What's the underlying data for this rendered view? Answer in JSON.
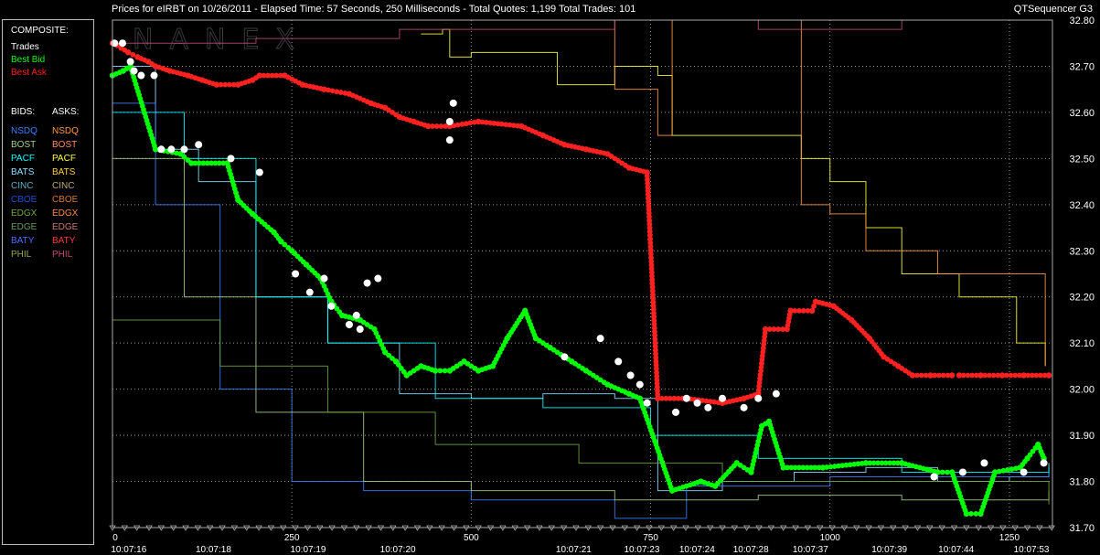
{
  "window": {
    "title": "Prices for  eIRBT  on  10/26/2011  -  Elapsed Time: 57 Seconds, 250 Milliseconds  -  Total Quotes: 1,199  Total Trades: 101",
    "app_name": "QTSequencer G3"
  },
  "watermark": "NANEX",
  "legend": {
    "composite_header": "COMPOSITE:",
    "composite": [
      {
        "label": "Trades",
        "color": "#ffffff"
      },
      {
        "label": "Best Bid",
        "color": "#00ff00"
      },
      {
        "label": "Best Ask",
        "color": "#ff2020"
      }
    ],
    "bids_header": "BIDS:",
    "asks_header": "ASKS:",
    "bids": [
      {
        "label": "NSDQ",
        "color": "#3f7fff"
      },
      {
        "label": "BOST",
        "color": "#a8d08a"
      },
      {
        "label": "PACF",
        "color": "#00ffff"
      },
      {
        "label": "BATS",
        "color": "#8fe0ff"
      },
      {
        "label": "CINC",
        "color": "#5fb0c0"
      },
      {
        "label": "CBOE",
        "color": "#1f4fd0"
      },
      {
        "label": "EDGX",
        "color": "#6fa83f"
      },
      {
        "label": "EDGE",
        "color": "#5f9f5f"
      },
      {
        "label": "BATY",
        "color": "#4f6fff"
      },
      {
        "label": "PHIL",
        "color": "#8faf40"
      }
    ],
    "asks": [
      {
        "label": "NSDQ",
        "color": "#ff9a3f"
      },
      {
        "label": "BOST",
        "color": "#ff8c60"
      },
      {
        "label": "PACF",
        "color": "#ffff40"
      },
      {
        "label": "BATS",
        "color": "#ffd040"
      },
      {
        "label": "CINC",
        "color": "#c0a878"
      },
      {
        "label": "CBOE",
        "color": "#d87a2a"
      },
      {
        "label": "EDGX",
        "color": "#ff8a50"
      },
      {
        "label": "EDGE",
        "color": "#d07a70"
      },
      {
        "label": "BATY",
        "color": "#ff3a3a"
      },
      {
        "label": "PHIL",
        "color": "#c04a78"
      }
    ]
  },
  "chart_data": {
    "type": "scatter",
    "y_axis": {
      "range": [
        31.7,
        32.8
      ],
      "ticks": [
        "32.80",
        "32.70",
        "32.60",
        "32.50",
        "32.40",
        "32.30",
        "32.20",
        "32.10",
        "32.00",
        "31.90",
        "31.80",
        "31.70"
      ],
      "side": "right"
    },
    "x_axis": {
      "range": [
        0,
        1310
      ],
      "count_ticks": [
        {
          "value": 0,
          "label": "0"
        },
        {
          "value": 250,
          "label": "250"
        },
        {
          "value": 500,
          "label": "500"
        },
        {
          "value": 750,
          "label": "750"
        },
        {
          "value": 1000,
          "label": "1000"
        },
        {
          "value": 1250,
          "label": "1250"
        }
      ],
      "time_ticks": [
        {
          "value": 10,
          "label": "10:07:16"
        },
        {
          "value": 128,
          "label": "10:07:18"
        },
        {
          "value": 260,
          "label": "10:07:19"
        },
        {
          "value": 385,
          "label": "10:07:20"
        },
        {
          "value": 630,
          "label": "10:07:21"
        },
        {
          "value": 725,
          "label": "10:07:23"
        },
        {
          "value": 802,
          "label": "10:07:24"
        },
        {
          "value": 877,
          "label": "10:07:28"
        },
        {
          "value": 960,
          "label": "10:07:37"
        },
        {
          "value": 1070,
          "label": "10:07:39"
        },
        {
          "value": 1163,
          "label": "10:07:44"
        },
        {
          "value": 1268,
          "label": "10:07:53"
        }
      ]
    },
    "grid": true,
    "series": [
      {
        "name": "Best Ask",
        "color": "#ff2020",
        "points": [
          [
            0,
            32.75
          ],
          [
            12,
            32.74
          ],
          [
            22,
            32.73
          ],
          [
            35,
            32.72
          ],
          [
            50,
            32.71
          ],
          [
            60,
            32.7
          ],
          [
            80,
            32.69
          ],
          [
            105,
            32.68
          ],
          [
            125,
            32.67
          ],
          [
            145,
            32.66
          ],
          [
            175,
            32.66
          ],
          [
            195,
            32.67
          ],
          [
            205,
            32.68
          ],
          [
            240,
            32.68
          ],
          [
            265,
            32.66
          ],
          [
            295,
            32.65
          ],
          [
            330,
            32.64
          ],
          [
            360,
            32.62
          ],
          [
            380,
            32.61
          ],
          [
            400,
            32.59
          ],
          [
            420,
            32.58
          ],
          [
            440,
            32.57
          ],
          [
            470,
            32.57
          ],
          [
            510,
            32.58
          ],
          [
            570,
            32.57
          ],
          [
            600,
            32.55
          ],
          [
            630,
            32.53
          ],
          [
            660,
            32.52
          ],
          [
            690,
            32.51
          ],
          [
            720,
            32.48
          ],
          [
            745,
            32.47
          ],
          [
            760,
            31.98
          ],
          [
            800,
            31.98
          ],
          [
            850,
            31.97
          ],
          [
            880,
            31.98
          ],
          [
            900,
            31.99
          ],
          [
            910,
            32.13
          ],
          [
            940,
            32.13
          ],
          [
            945,
            32.17
          ],
          [
            975,
            32.17
          ],
          [
            980,
            32.19
          ],
          [
            1005,
            32.18
          ],
          [
            1030,
            32.15
          ],
          [
            1055,
            32.11
          ],
          [
            1075,
            32.07
          ],
          [
            1095,
            32.05
          ],
          [
            1115,
            32.03
          ],
          [
            1140,
            32.03
          ],
          [
            1170,
            32.03
          ],
          [
            1180,
            32.03
          ],
          [
            1210,
            32.03
          ],
          [
            1240,
            32.03
          ],
          [
            1270,
            32.03
          ],
          [
            1305,
            32.03
          ]
        ]
      },
      {
        "name": "Best Bid",
        "color": "#00ff00",
        "points": [
          [
            0,
            32.68
          ],
          [
            15,
            32.69
          ],
          [
            25,
            32.7
          ],
          [
            60,
            32.52
          ],
          [
            95,
            32.51
          ],
          [
            110,
            32.49
          ],
          [
            160,
            32.49
          ],
          [
            175,
            32.41
          ],
          [
            195,
            32.38
          ],
          [
            225,
            32.34
          ],
          [
            235,
            32.32
          ],
          [
            250,
            32.3
          ],
          [
            270,
            32.27
          ],
          [
            290,
            32.24
          ],
          [
            305,
            32.19
          ],
          [
            320,
            32.16
          ],
          [
            345,
            32.15
          ],
          [
            365,
            32.13
          ],
          [
            380,
            32.08
          ],
          [
            395,
            32.06
          ],
          [
            410,
            32.03
          ],
          [
            430,
            32.05
          ],
          [
            450,
            32.04
          ],
          [
            470,
            32.04
          ],
          [
            490,
            32.06
          ],
          [
            510,
            32.04
          ],
          [
            530,
            32.05
          ],
          [
            550,
            32.11
          ],
          [
            575,
            32.17
          ],
          [
            590,
            32.11
          ],
          [
            610,
            32.09
          ],
          [
            640,
            32.06
          ],
          [
            660,
            32.04
          ],
          [
            690,
            32.01
          ],
          [
            720,
            31.99
          ],
          [
            735,
            31.98
          ],
          [
            780,
            31.78
          ],
          [
            820,
            31.8
          ],
          [
            840,
            31.79
          ],
          [
            870,
            31.84
          ],
          [
            890,
            31.82
          ],
          [
            905,
            31.92
          ],
          [
            915,
            31.93
          ],
          [
            935,
            31.83
          ],
          [
            990,
            31.83
          ],
          [
            1050,
            31.84
          ],
          [
            1100,
            31.84
          ],
          [
            1150,
            31.82
          ],
          [
            1170,
            31.82
          ],
          [
            1190,
            31.73
          ],
          [
            1210,
            31.73
          ],
          [
            1230,
            31.82
          ],
          [
            1265,
            31.83
          ],
          [
            1275,
            31.85
          ],
          [
            1290,
            31.88
          ],
          [
            1298,
            31.85
          ]
        ]
      },
      {
        "name": "Trades",
        "color": "#ffffff",
        "points": [
          [
            3,
            32.75
          ],
          [
            14,
            32.75
          ],
          [
            25,
            32.71
          ],
          [
            30,
            32.69
          ],
          [
            40,
            32.68
          ],
          [
            58,
            32.68
          ],
          [
            68,
            32.52
          ],
          [
            82,
            32.52
          ],
          [
            100,
            32.52
          ],
          [
            120,
            32.53
          ],
          [
            165,
            32.5
          ],
          [
            205,
            32.47
          ],
          [
            255,
            32.25
          ],
          [
            275,
            32.21
          ],
          [
            295,
            32.24
          ],
          [
            305,
            32.18
          ],
          [
            330,
            32.14
          ],
          [
            340,
            32.16
          ],
          [
            345,
            32.13
          ],
          [
            370,
            32.24
          ],
          [
            355,
            32.23
          ],
          [
            470,
            32.54
          ],
          [
            470,
            32.58
          ],
          [
            475,
            32.62
          ],
          [
            680,
            32.11
          ],
          [
            630,
            32.07
          ],
          [
            705,
            32.06
          ],
          [
            722,
            32.03
          ],
          [
            735,
            32.01
          ],
          [
            745,
            31.97
          ],
          [
            785,
            31.95
          ],
          [
            800,
            31.98
          ],
          [
            815,
            31.97
          ],
          [
            830,
            31.96
          ],
          [
            850,
            31.98
          ],
          [
            880,
            31.96
          ],
          [
            900,
            31.98
          ],
          [
            925,
            31.99
          ],
          [
            1145,
            31.81
          ],
          [
            1185,
            31.82
          ],
          [
            1215,
            31.84
          ],
          [
            1270,
            31.82
          ],
          [
            1298,
            31.84
          ]
        ]
      },
      {
        "name": "Ask: PACF",
        "color": "#ffff40",
        "points": [
          [
            430,
            32.77
          ],
          [
            460,
            32.78
          ],
          [
            470,
            32.72
          ],
          [
            500,
            32.73
          ],
          [
            620,
            32.66
          ],
          [
            700,
            32.7
          ],
          [
            760,
            32.68
          ],
          [
            780,
            32.55
          ],
          [
            900,
            32.55
          ],
          [
            960,
            32.5
          ],
          [
            1000,
            32.45
          ],
          [
            1050,
            32.35
          ],
          [
            1100,
            32.25
          ],
          [
            1180,
            32.2
          ],
          [
            1260,
            32.1
          ],
          [
            1300,
            32.05
          ]
        ]
      },
      {
        "name": "Ask: NSDQ",
        "color": "#ff9a3f",
        "points": [
          [
            500,
            32.8
          ],
          [
            600,
            32.8
          ],
          [
            700,
            32.65
          ],
          [
            760,
            32.55
          ],
          [
            780,
            32.8
          ],
          [
            900,
            32.8
          ],
          [
            960,
            32.4
          ],
          [
            1000,
            32.38
          ],
          [
            1050,
            32.3
          ],
          [
            1150,
            32.25
          ],
          [
            1300,
            32.05
          ]
        ]
      },
      {
        "name": "Ask: PHIL",
        "color": "#c04a78",
        "points": [
          [
            0,
            32.75
          ],
          [
            200,
            32.76
          ],
          [
            400,
            32.78
          ],
          [
            700,
            32.8
          ],
          [
            900,
            32.78
          ],
          [
            1100,
            32.8
          ],
          [
            1300,
            32.8
          ]
        ]
      },
      {
        "name": "Bid: BATS",
        "color": "#8fe0ff",
        "points": [
          [
            0,
            32.7
          ],
          [
            60,
            32.52
          ],
          [
            120,
            32.45
          ],
          [
            200,
            32.2
          ],
          [
            300,
            32.1
          ],
          [
            400,
            31.99
          ],
          [
            500,
            31.98
          ],
          [
            600,
            31.99
          ],
          [
            700,
            31.98
          ],
          [
            760,
            31.78
          ],
          [
            850,
            31.8
          ],
          [
            950,
            31.82
          ],
          [
            1050,
            31.83
          ],
          [
            1150,
            31.8
          ],
          [
            1250,
            31.81
          ],
          [
            1305,
            31.84
          ]
        ]
      },
      {
        "name": "Bid: NSDQ",
        "color": "#3f7fff",
        "points": [
          [
            0,
            32.62
          ],
          [
            60,
            32.4
          ],
          [
            150,
            32.0
          ],
          [
            250,
            31.8
          ],
          [
            350,
            31.78
          ],
          [
            500,
            31.76
          ],
          [
            700,
            31.72
          ],
          [
            800,
            31.79
          ],
          [
            1000,
            31.81
          ],
          [
            1305,
            31.82
          ]
        ]
      },
      {
        "name": "Bid: PACF",
        "color": "#00ffff",
        "points": [
          [
            0,
            32.6
          ],
          [
            100,
            32.5
          ],
          [
            200,
            32.2
          ],
          [
            300,
            32.1
          ],
          [
            450,
            31.98
          ],
          [
            600,
            31.96
          ],
          [
            750,
            31.9
          ],
          [
            900,
            31.85
          ],
          [
            1100,
            31.82
          ],
          [
            1305,
            31.83
          ]
        ]
      },
      {
        "name": "Bid: BOST",
        "color": "#a8d08a",
        "points": [
          [
            0,
            32.5
          ],
          [
            100,
            32.2
          ],
          [
            200,
            31.95
          ],
          [
            350,
            31.8
          ],
          [
            500,
            31.78
          ],
          [
            700,
            31.76
          ],
          [
            900,
            31.77
          ],
          [
            1100,
            31.76
          ],
          [
            1305,
            31.78
          ]
        ]
      },
      {
        "name": "Bid: EDGX",
        "color": "#6fa83f",
        "points": [
          [
            0,
            32.15
          ],
          [
            150,
            32.05
          ],
          [
            300,
            31.95
          ],
          [
            450,
            31.88
          ],
          [
            650,
            31.84
          ],
          [
            850,
            31.8
          ],
          [
            1050,
            31.8
          ],
          [
            1305,
            31.75
          ]
        ]
      }
    ]
  }
}
